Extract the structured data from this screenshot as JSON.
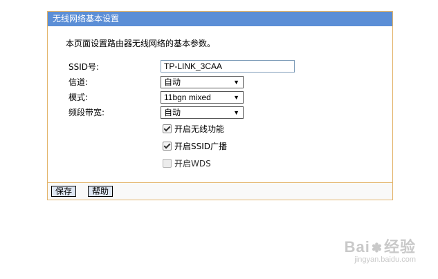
{
  "panel": {
    "title": "无线网络基本设置",
    "intro": "本页面设置路由器无线网络的基本参数。"
  },
  "form": {
    "ssid_label": "SSID号:",
    "ssid_value": "TP-LINK_3CAA",
    "channel_label": "信道:",
    "channel_value": "自动",
    "mode_label": "模式:",
    "mode_value": "11bgn mixed",
    "bandwidth_label": "频段带宽:",
    "bandwidth_value": "自动",
    "dropdown_arrow": "▼"
  },
  "checks": [
    {
      "label": "开启无线功能",
      "checked": true
    },
    {
      "label": "开启SSID广播",
      "checked": true
    },
    {
      "label": "开启WDS",
      "checked": false
    }
  ],
  "footer": {
    "save_label": "保存",
    "help_label": "帮助"
  },
  "watermark": {
    "brand_left": "Bai",
    "brand_right": "经验",
    "url": "jingyan.baidu.com"
  },
  "colors": {
    "header_bg": "#5b8ed6",
    "panel_border": "#e3b46a",
    "button_bg": "#dfe7f3"
  }
}
